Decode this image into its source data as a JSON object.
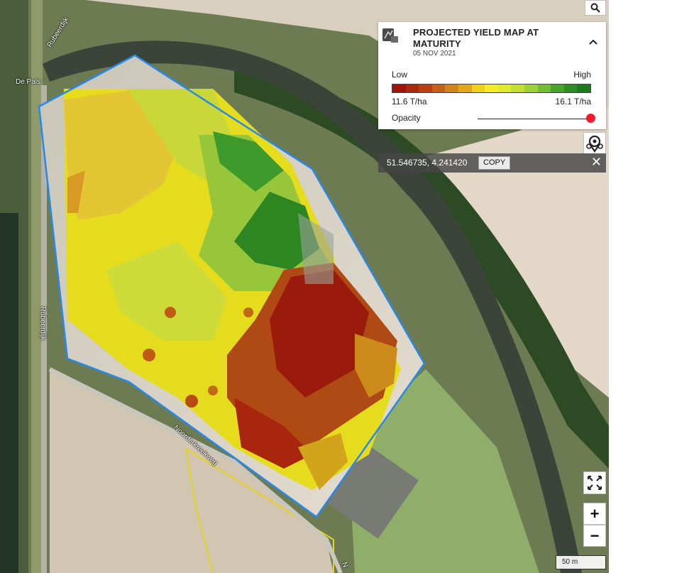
{
  "legend": {
    "title": "PROJECTED YIELD MAP AT MATURITY",
    "date": "05 NOV 2021",
    "low_label": "Low",
    "high_label": "High",
    "min_value": "11.6 T/ha",
    "max_value": "16.1 T/ha",
    "opacity_label": "Opacity",
    "opacity_value": 1.0,
    "palette": [
      "#a0140c",
      "#aa2a10",
      "#b84012",
      "#c46018",
      "#d0851a",
      "#e0a81a",
      "#eed21c",
      "#f4ec28",
      "#dcea2a",
      "#c2de32",
      "#9ed036",
      "#74bc34",
      "#4aa42c",
      "#2e8c24",
      "#1e7a1e"
    ]
  },
  "coordinates": {
    "text": "51.546735, 4.241420",
    "copy_label": "COPY"
  },
  "map_labels": {
    "rubeerdijk_top": "Rubeerdijk",
    "de_pals": "De Pals",
    "rubeerdijk_left": "Rubeerdijk",
    "noorderkreekweg": "Noorderkreekweg",
    "bottom_road": "N"
  },
  "controls": {
    "search_icon": "search-icon",
    "location_icon": "locations-icon",
    "fullscreen_icon": "fullscreen-icon",
    "zoom_in_label": "+",
    "zoom_out_label": "−",
    "scale_label": "50 m"
  },
  "colors": {
    "field_boundary": "#2a88e8",
    "neighbour_boundary": "#e4d21e",
    "slider_knob": "#ee1c2e"
  }
}
